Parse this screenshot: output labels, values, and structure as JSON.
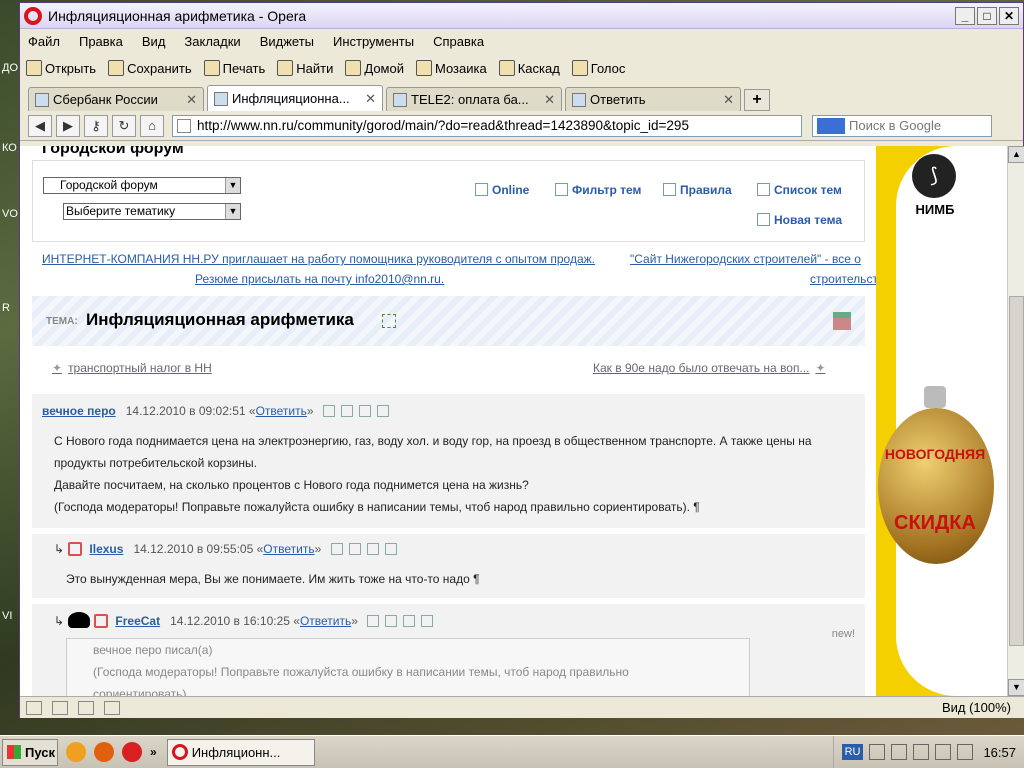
{
  "window": {
    "title": "Инфляцияционная арифметика - Opera"
  },
  "menu": [
    "Файл",
    "Правка",
    "Вид",
    "Закладки",
    "Виджеты",
    "Инструменты",
    "Справка"
  ],
  "toolbar": [
    "Открыть",
    "Сохранить",
    "Печать",
    "Найти",
    "Домой",
    "Мозаика",
    "Каскад",
    "Голос"
  ],
  "tabs": [
    {
      "label": "Сбербанк России"
    },
    {
      "label": "Инфляцияционна..."
    },
    {
      "label": "TELE2: оплата ба..."
    },
    {
      "label": "Ответить"
    }
  ],
  "address": {
    "url": "http://www.nn.ru/community/gorod/main/?do=read&thread=1423890&topic_id=295"
  },
  "search": {
    "placeholder": "Поиск в Google"
  },
  "forum": {
    "cut_header": "Городской форум",
    "forum_select": "Городской форум",
    "theme_select": "Выберите тематику",
    "links": {
      "online": "Online",
      "filter": "Фильтр тем",
      "rules": "Правила",
      "list": "Список тем",
      "new_topic": "Новая тема"
    }
  },
  "ads": {
    "left_line1": "ИНТЕРНЕТ-КОМПАНИЯ НН.РУ приглашает на работу помощника руководителя с опытом продаж.",
    "left_line2": "Резюме присылать на почту info2010@nn.ru.",
    "right_line1": "\"Сайт Нижегородских строителей\" - все о",
    "right_line2": "строительстве"
  },
  "topic": {
    "prefix": "ТЕМА:",
    "title": "Инфляцияционная арифметика"
  },
  "nav": {
    "prev": "транспортный налог в НН",
    "next": "Как в 90е надо было отвечать на воп..."
  },
  "posts": [
    {
      "author": "вечное перо",
      "date": "14.12.2010 в 09:02:51",
      "reply": "Ответить",
      "lines": [
        "С Нового года поднимается цена на электроэнергию, газ, воду хол. и воду гор, на проезд в общественном транспорте. А также цены на",
        "продукты потребительской корзины.",
        "Давайте посчитаем, на сколько процентов с Нового года поднимется цена на жизнь?",
        "(Господа модераторы! Поправьте пожалуйста ошибку в написании темы, чтоб народ правильно сориентировать). ¶"
      ]
    },
    {
      "author": "Ilexus",
      "date": "14.12.2010 в 09:55:05",
      "reply": "Ответить",
      "lines": [
        "Это вынужденная мера, Вы же понимаете. Им жить тоже на что-то надо ¶"
      ]
    },
    {
      "author": "FreeCat",
      "date": "14.12.2010 в 16:10:25",
      "reply": "Ответить",
      "new_label": "new!",
      "quote_lines": [
        "вечное перо писал(а)",
        "(Господа модераторы! Поправьте пожалуйста ошибку в написании темы, чтоб народ правильно",
        "сориентировать)"
      ]
    }
  ],
  "banner": {
    "brand": "НИМБ",
    "text1": "НОВОГОДНЯЯ",
    "text2": "СКИДКА"
  },
  "status": {
    "zoom": "Вид (100%)"
  },
  "taskbar": {
    "start": "Пуск",
    "task": "Инфляционн...",
    "lang": "RU",
    "clock": "16:57"
  },
  "desktop_labels": [
    "ДО",
    "КО",
    "VO",
    "R",
    "VI"
  ]
}
